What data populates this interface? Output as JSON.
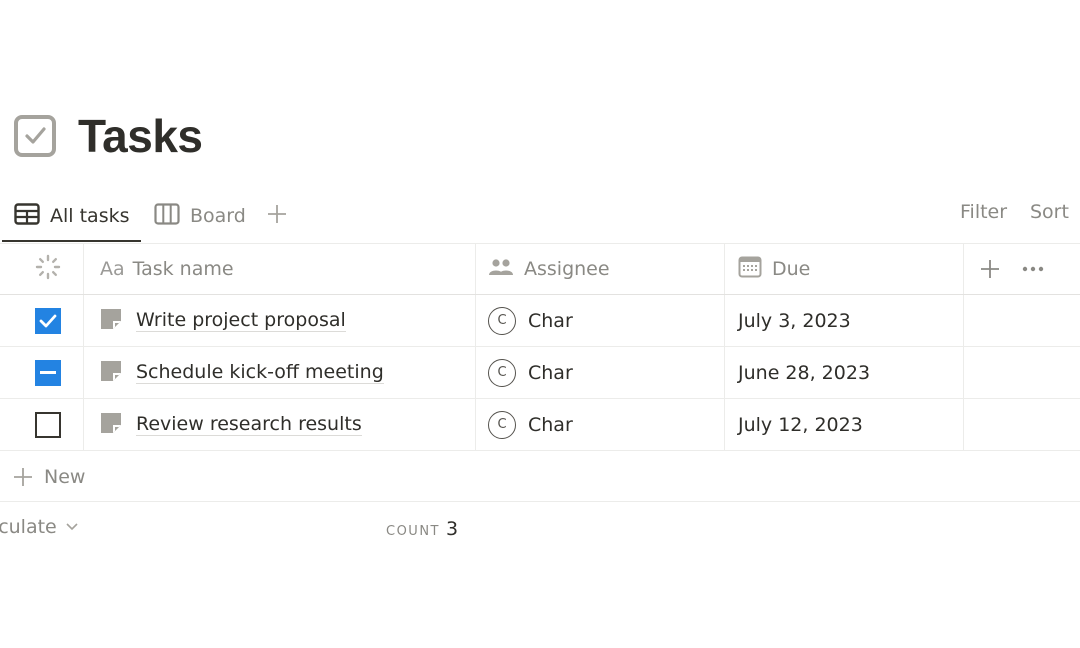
{
  "page": {
    "title": "Tasks",
    "title_icon": "checkbox-icon"
  },
  "views": {
    "tabs": [
      {
        "label": "All tasks",
        "icon": "table-icon",
        "active": true
      },
      {
        "label": "Board",
        "icon": "board-icon",
        "active": false
      }
    ],
    "add_view_icon": "plus-icon",
    "actions": {
      "filter": "Filter",
      "sort": "Sort"
    }
  },
  "table": {
    "columns": [
      {
        "key": "status",
        "label": "",
        "icon": "status-loader-icon"
      },
      {
        "key": "name",
        "label": "Task name",
        "prefix": "Aa",
        "icon": "title-icon"
      },
      {
        "key": "assignee",
        "label": "Assignee",
        "icon": "people-icon"
      },
      {
        "key": "due",
        "label": "Due",
        "icon": "calendar-icon"
      }
    ],
    "add_column_icon": "plus-icon",
    "more_icon": "ellipsis-icon",
    "rows": [
      {
        "status": "checked",
        "name": "Write project proposal",
        "assignee": {
          "initial": "C",
          "name": "Char"
        },
        "due": "July 3, 2023"
      },
      {
        "status": "partial",
        "name": "Schedule kick-off meeting",
        "assignee": {
          "initial": "C",
          "name": "Char"
        },
        "due": "June 28, 2023"
      },
      {
        "status": "unchecked",
        "name": "Review research results",
        "assignee": {
          "initial": "C",
          "name": "Char"
        },
        "due": "July 12, 2023"
      }
    ],
    "new_row_label": "New",
    "footer": {
      "calculate_label": "Calculate",
      "count_label": "COUNT",
      "count_value": "3"
    }
  },
  "colors": {
    "accent": "#2383e2",
    "text": "#37352f",
    "muted": "#8a8984",
    "border": "#ececea"
  }
}
